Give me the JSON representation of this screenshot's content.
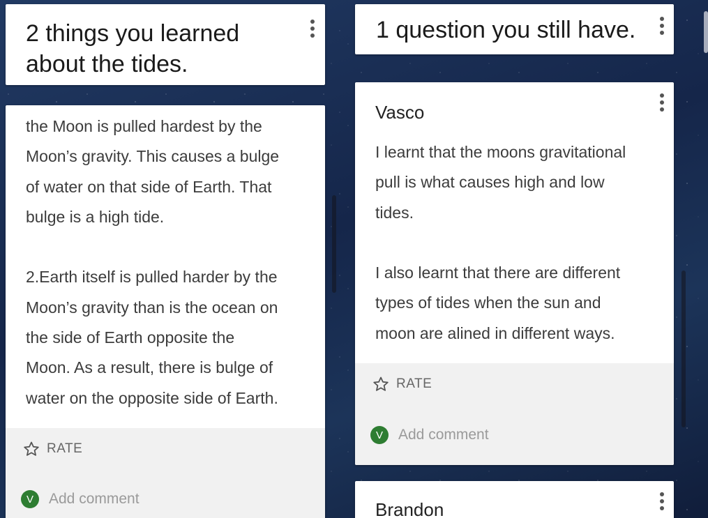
{
  "columns": [
    {
      "header": "2 things you learned about the tides.",
      "posts": [
        {
          "author": "",
          "body": "the Moon is pulled hardest by the\nMoon’s gravity. This causes a bulge\nof water on that side of Earth. That\nbulge is a high tide.\n\n2.Earth itself is pulled harder by the\nMoon’s gravity than is the ocean on\nthe side of Earth opposite the\nMoon. As a result, there is bulge of\nwater on the opposite side of Earth.",
          "rate_label": "RATE",
          "comment_placeholder": "Add comment",
          "avatar_initial": "V"
        }
      ]
    },
    {
      "header": "1 question you still have.",
      "posts": [
        {
          "author": "Vasco",
          "body": "I learnt that the moons gravitational\npull is what causes high and low\ntides.\n\nI also learnt that there are different\ntypes of tides when the sun and\nmoon are alined in different ways.",
          "rate_label": "RATE",
          "comment_placeholder": "Add comment",
          "avatar_initial": "V"
        },
        {
          "author": "Brandon"
        }
      ]
    }
  ],
  "colors": {
    "avatar": "#2e7d32",
    "footer": "#f1f1f1",
    "background": "#182c4e"
  },
  "icons": {
    "more": "kebab-menu-icon",
    "rate": "star-outline-icon"
  }
}
